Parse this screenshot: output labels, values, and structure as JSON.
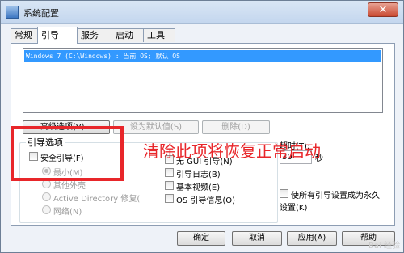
{
  "window": {
    "title": "系统配置",
    "close_glyph": "✕"
  },
  "tabs": [
    "常规",
    "引导",
    "服务",
    "启动",
    "工具"
  ],
  "os_list": {
    "entries": [
      "Windows 7 (C:\\Windows) : 当前 OS; 默认 OS"
    ]
  },
  "list_buttons": {
    "advanced": "高级选项(V)...",
    "set_default": "设为默认值(S)",
    "delete": "删除(D)"
  },
  "boot_options": {
    "group_label": "引导选项",
    "safe_boot": "安全引导(F)",
    "minimal": "最小(M)",
    "alternate_shell": "其他外壳",
    "active_directory": "Active Directory 修复(",
    "network": "网络(N)"
  },
  "right_options": {
    "no_gui": "无 GUI 引导(N)",
    "boot_log": "引导日志(B)",
    "base_video": "基本视频(E)",
    "os_info": "OS 引导信息(O)"
  },
  "timeout": {
    "label": "超时(T):",
    "value": "30",
    "unit": "秒"
  },
  "make_permanent": {
    "line1": "使所有引导设置成为永久",
    "line2": "设置(K)"
  },
  "annotation": {
    "text": "清除此项将恢复正常启动"
  },
  "footer_buttons": {
    "ok": "确定",
    "cancel": "取消",
    "apply": "应用(A)",
    "help": "帮助"
  },
  "watermark": "Bai 经验"
}
